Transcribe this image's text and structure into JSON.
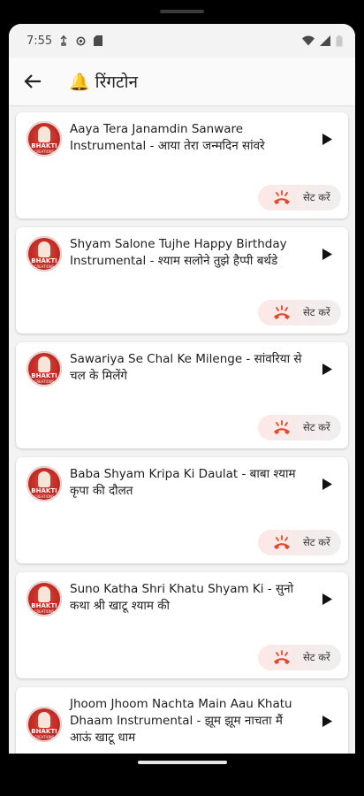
{
  "status_bar": {
    "time": "7:55"
  },
  "app_bar": {
    "title": "रिंगटोन",
    "bell_icon": "🔔"
  },
  "logo": {
    "line1": "BHAKTI",
    "line2": "CREATIONS"
  },
  "ringtones": [
    {
      "title": "Aaya Tera Janamdin Sanware Instrumental - आया तेरा जन्मदिन सांवरे",
      "set_label": "सेट करें"
    },
    {
      "title": "Shyam Salone Tujhe Happy Birthday Instrumental - श्याम सलोने तुझे हैप्पी बर्थडे",
      "set_label": "सेट करें"
    },
    {
      "title": "Sawariya Se Chal Ke Milenge - सांवरिया से चल के मिलेंगे",
      "set_label": "सेट करें"
    },
    {
      "title": "Baba Shyam Kripa Ki Daulat - बाबा श्याम कृपा की दौलत",
      "set_label": "सेट करें"
    },
    {
      "title": "Suno Katha Shri Khatu Shyam Ki - सुनो कथा श्री खाटू श्याम की",
      "set_label": "सेट करें"
    },
    {
      "title": "Jhoom Jhoom Nachta Main Aau Khatu Dhaam Instrumental - झूम झूम नाचता मैं आऊं खाटू धाम"
    }
  ],
  "colors": {
    "accent": "#e5472b",
    "logo_red": "#b8201a"
  }
}
